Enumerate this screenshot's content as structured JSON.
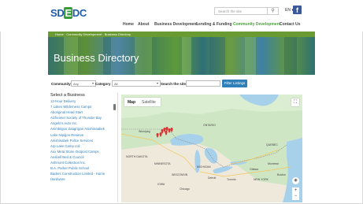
{
  "header": {
    "logo_text_left": "SD",
    "logo_text_mid": "E",
    "logo_text_right": "DC",
    "search_placeholder": "Search the site",
    "language": "EN",
    "nav": [
      "Home",
      "About",
      "Business Development",
      "Lending & Funding",
      "Community Development",
      "Contact Us"
    ],
    "nav_active_index": 4
  },
  "breadcrumb": [
    "Home",
    "Community Development",
    "Business Directory"
  ],
  "hero": {
    "title": "Business Directory"
  },
  "filters": {
    "community_label": "Community",
    "community_value": "Any",
    "category_label": "Category",
    "category_value": "All",
    "search_label": "Search the site",
    "button_label": "Filter Listings"
  },
  "list": {
    "title": "Select a Business",
    "items": [
      "12-Hour Delivery",
      "7 Lakes Wilderness Camps",
      "Aboriginal Head Start",
      "Alzheimer Society of Thunder Bay",
      "Angelo's Auto Inc.",
      "Animbiigoo Zaagi'igan Anishinaabek",
      "Lake Nipigon Reserve",
      "Anishinabek Police Services",
      "Arp Lake Camp Ltd.",
      "Aux Meta Stone Outpost Camps",
      "Ansbell Bed & Council",
      "Ashmont Collection Inc.",
      "B.A. Parker Public School",
      "Baders Construction Limited - Home",
      "Hardware"
    ]
  },
  "map": {
    "tab_map": "Map",
    "tab_satellite": "Satellite",
    "labels": [
      "Winnipeg",
      "ONTARIO",
      "QUEBEC",
      "Montreal",
      "Ottawa",
      "Toronto",
      "Chicago",
      "Detroit",
      "MINNESOTA",
      "NORTH DAKOTA",
      "WISCONSIN",
      "MICHIGAN",
      "NEW YORK",
      "IOWA",
      "Boston"
    ]
  },
  "colors": {
    "brand_blue": "#1f5ca8",
    "brand_green": "#4aa03a",
    "button_blue": "#2f7fb8",
    "link_blue": "#2f7fb8"
  }
}
